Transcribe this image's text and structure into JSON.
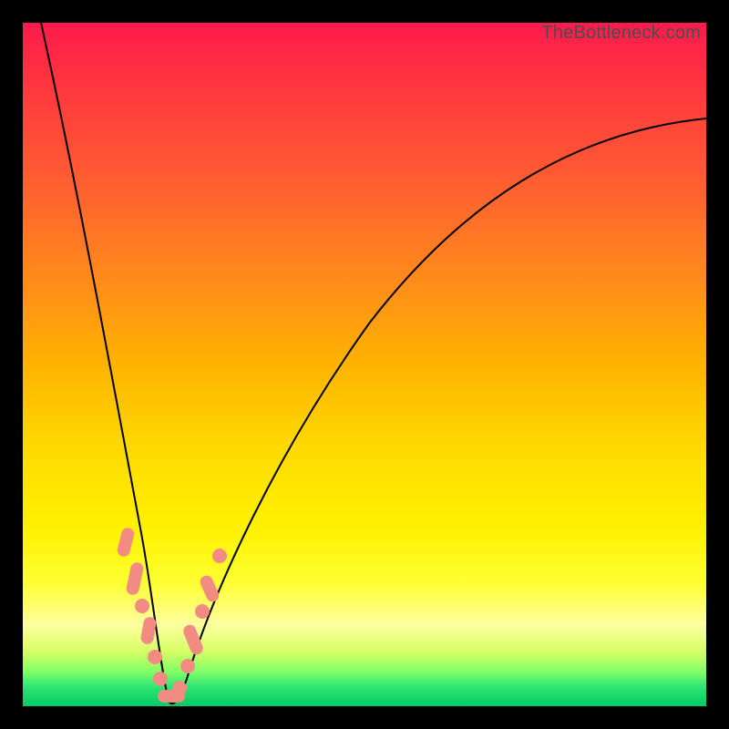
{
  "watermark": "TheBottleneck.com",
  "colors": {
    "dot": "#f28b82",
    "curve": "#000000"
  },
  "chart_data": {
    "type": "line",
    "title": "",
    "xlabel": "",
    "ylabel": "",
    "xlim": [
      0,
      100
    ],
    "ylim": [
      0,
      100
    ],
    "grid": false,
    "note": "V-shaped bottleneck curve. x is normalized component ratio (0–100), y is bottleneck percentage (0 = no bottleneck at valley, 100 = severe). Curve minimum near x≈21.",
    "series": [
      {
        "name": "bottleneck-curve",
        "x": [
          0,
          2,
          4,
          6,
          8,
          10,
          12,
          14,
          16,
          17,
          18,
          19,
          20,
          21,
          22,
          23,
          24,
          26,
          28,
          30,
          34,
          38,
          42,
          46,
          50,
          55,
          60,
          65,
          70,
          75,
          80,
          85,
          90,
          95,
          100
        ],
        "values": [
          100,
          90,
          80,
          70,
          59,
          48,
          38,
          28,
          18,
          13,
          9,
          5,
          2,
          0,
          2,
          5,
          8,
          13,
          18,
          22,
          30,
          37,
          43,
          49,
          54,
          60,
          65,
          69,
          73,
          76,
          79,
          81,
          83,
          84.5,
          86
        ]
      }
    ],
    "highlight_points": {
      "note": "Salmon markers clustered along lower portion of both arms of the V, roughly y∈[0,25].",
      "x": [
        14.7,
        15.7,
        16.7,
        17.3,
        18.0,
        18.7,
        19.7,
        20.3,
        21.3,
        22.3,
        23.0,
        23.7,
        24.7,
        25.3,
        26.3,
        27.3,
        28.7
      ],
      "values": [
        25.3,
        20.7,
        16.0,
        13.0,
        10.0,
        6.7,
        3.0,
        1.0,
        0.3,
        2.3,
        4.7,
        7.3,
        10.7,
        13.0,
        15.7,
        18.3,
        22.7
      ]
    }
  }
}
